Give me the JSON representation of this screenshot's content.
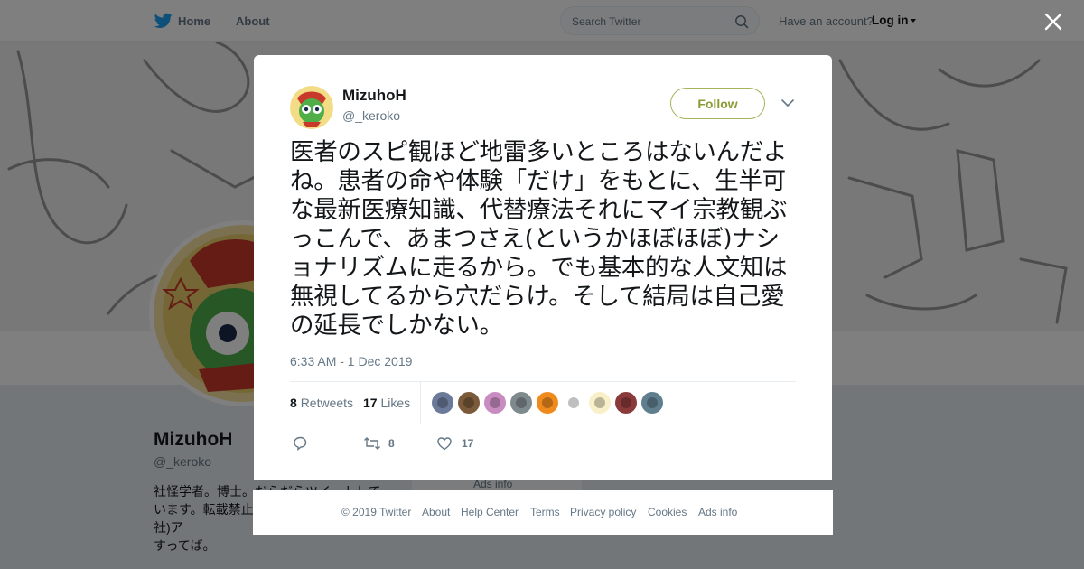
{
  "nav": {
    "home_label": "Home",
    "about_label": "About",
    "search_placeholder": "Search Twitter",
    "have_account": "Have an account?",
    "login_label": "Log in"
  },
  "profile": {
    "name": "MizuhoH",
    "handle": "@_keroko",
    "bio": "社怪学者。博士。だらだらツイートしています。転載禁止。「ネコとたち」(青弓社)ア　　　　　　　　　ぐらツイート消すってば。"
  },
  "sidebar": {
    "ads_info": "Ads info"
  },
  "tweet": {
    "author_name": "MizuhoH",
    "author_handle": "@_keroko",
    "follow_label": "Follow",
    "text": "医者のスピ観ほど地雷多いところはないんだよね。患者の命や体験「だけ」をもとに、生半可な最新医療知識、代替療法それにマイ宗教観ぶっこんで、あまつさえ(というかほぼほぼ)ナショナリズムに走るから。でも基本的な人文知は無視してるから穴だらけ。そして結局は自己愛の延長でしかない。",
    "timestamp": "6:33 AM - 1 Dec 2019",
    "retweets_count": "8",
    "retweets_label": "Retweets",
    "likes_count": "17",
    "likes_label": "Likes",
    "action_retweet_count": "8",
    "action_like_count": "17",
    "liker_count": 9
  },
  "footer": {
    "copyright": "© 2019 Twitter",
    "about": "About",
    "help": "Help Center",
    "terms": "Terms",
    "privacy": "Privacy policy",
    "cookies": "Cookies",
    "ads": "Ads info"
  },
  "colors": {
    "follow_accent": "#8a9a34",
    "overlay": "rgba(0,0,0,0.5)",
    "twitter_blue": "#1da1f2"
  }
}
